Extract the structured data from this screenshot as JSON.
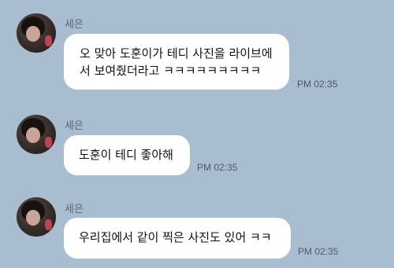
{
  "messages": [
    {
      "sender": "세은",
      "lines": [
        "오 맞아 도훈이가 테디 사진을 라이브에",
        "서 보여줬더라고 ㅋㅋㅋㅋㅋㅋㅋㅋㅋ"
      ],
      "time": "PM 02:35"
    },
    {
      "sender": "세은",
      "lines": [
        "도훈이 테디 좋아해"
      ],
      "time": "PM 02:35"
    },
    {
      "sender": "세은",
      "lines": [
        "우리집에서 같이 찍은 사진도 있어 ㅋㅋ"
      ],
      "time": "PM 02:35"
    }
  ]
}
